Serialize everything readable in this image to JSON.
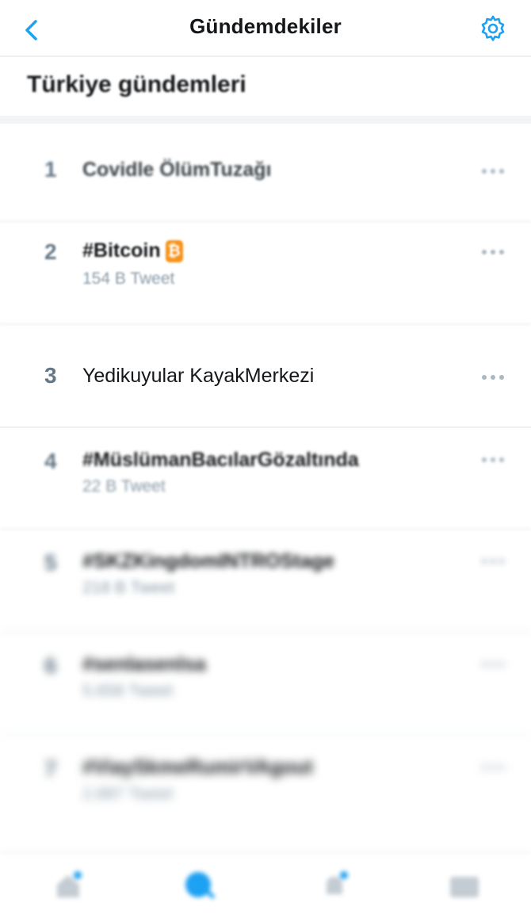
{
  "header": {
    "back_icon": "chevron-left-icon",
    "title": "Gündemdekiler",
    "settings_icon": "gear-icon",
    "accent_color": "#1da1f2"
  },
  "section": {
    "title": "Türkiye gündemleri"
  },
  "trends": [
    {
      "rank": "1",
      "name": "Covidle ÖlümTuzağı",
      "count": ""
    },
    {
      "rank": "2",
      "name": "#Bitcoin",
      "count": "154 B Tweet",
      "icon": "bitcoin-emoji-icon"
    },
    {
      "rank": "3",
      "name": "Yedikuyular KayakMerkezi",
      "count": ""
    },
    {
      "rank": "4",
      "name": "#MüslümanBacılarGözaltında",
      "count": "22 B Tweet"
    },
    {
      "rank": "5",
      "name": "#SKZKingdomINTROStage",
      "count": "218 B Tweet"
    },
    {
      "rank": "6",
      "name": "#senlasenlsa",
      "count": "5.658 Tweet"
    },
    {
      "rank": "7",
      "name": "#ViaySkmeRumirVAgout",
      "count": "2.887 Tweet"
    }
  ],
  "more_icon": "more-horizontal-icon",
  "bottom_tabs": [
    {
      "name": "home-icon"
    },
    {
      "name": "search-icon"
    },
    {
      "name": "notifications-icon"
    },
    {
      "name": "messages-icon"
    }
  ]
}
